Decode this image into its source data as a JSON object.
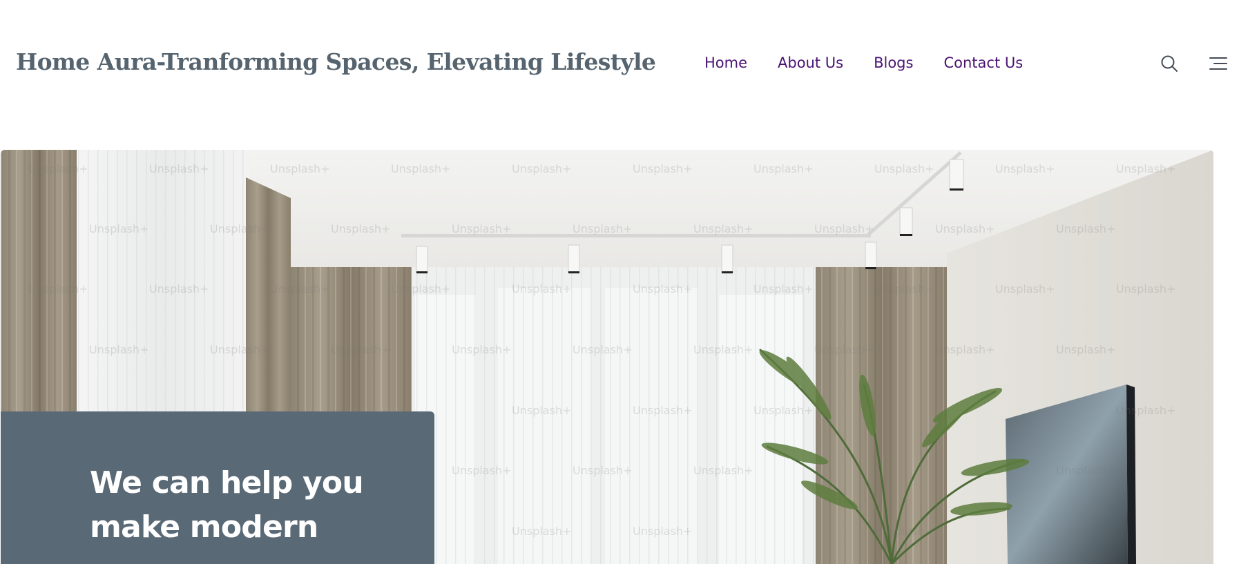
{
  "header": {
    "site_title": "Home Aura-Tranforming Spaces, Elevating Lifestyle",
    "nav": [
      {
        "label": "Home"
      },
      {
        "label": "About Us"
      },
      {
        "label": "Blogs"
      },
      {
        "label": "Contact Us"
      }
    ],
    "search_icon": "search-icon",
    "menu_icon": "hamburger-menu-icon"
  },
  "hero": {
    "image_subject": "modern living room with sheer curtains, patterned drapes, track lighting, palm plant and TV",
    "watermark_text": "Unsplash+",
    "heading": "We can help you make modern"
  },
  "colors": {
    "title": "#56646f",
    "nav_link": "#4a1373",
    "card_bg": "#5a6976",
    "card_text": "#ffffff"
  }
}
